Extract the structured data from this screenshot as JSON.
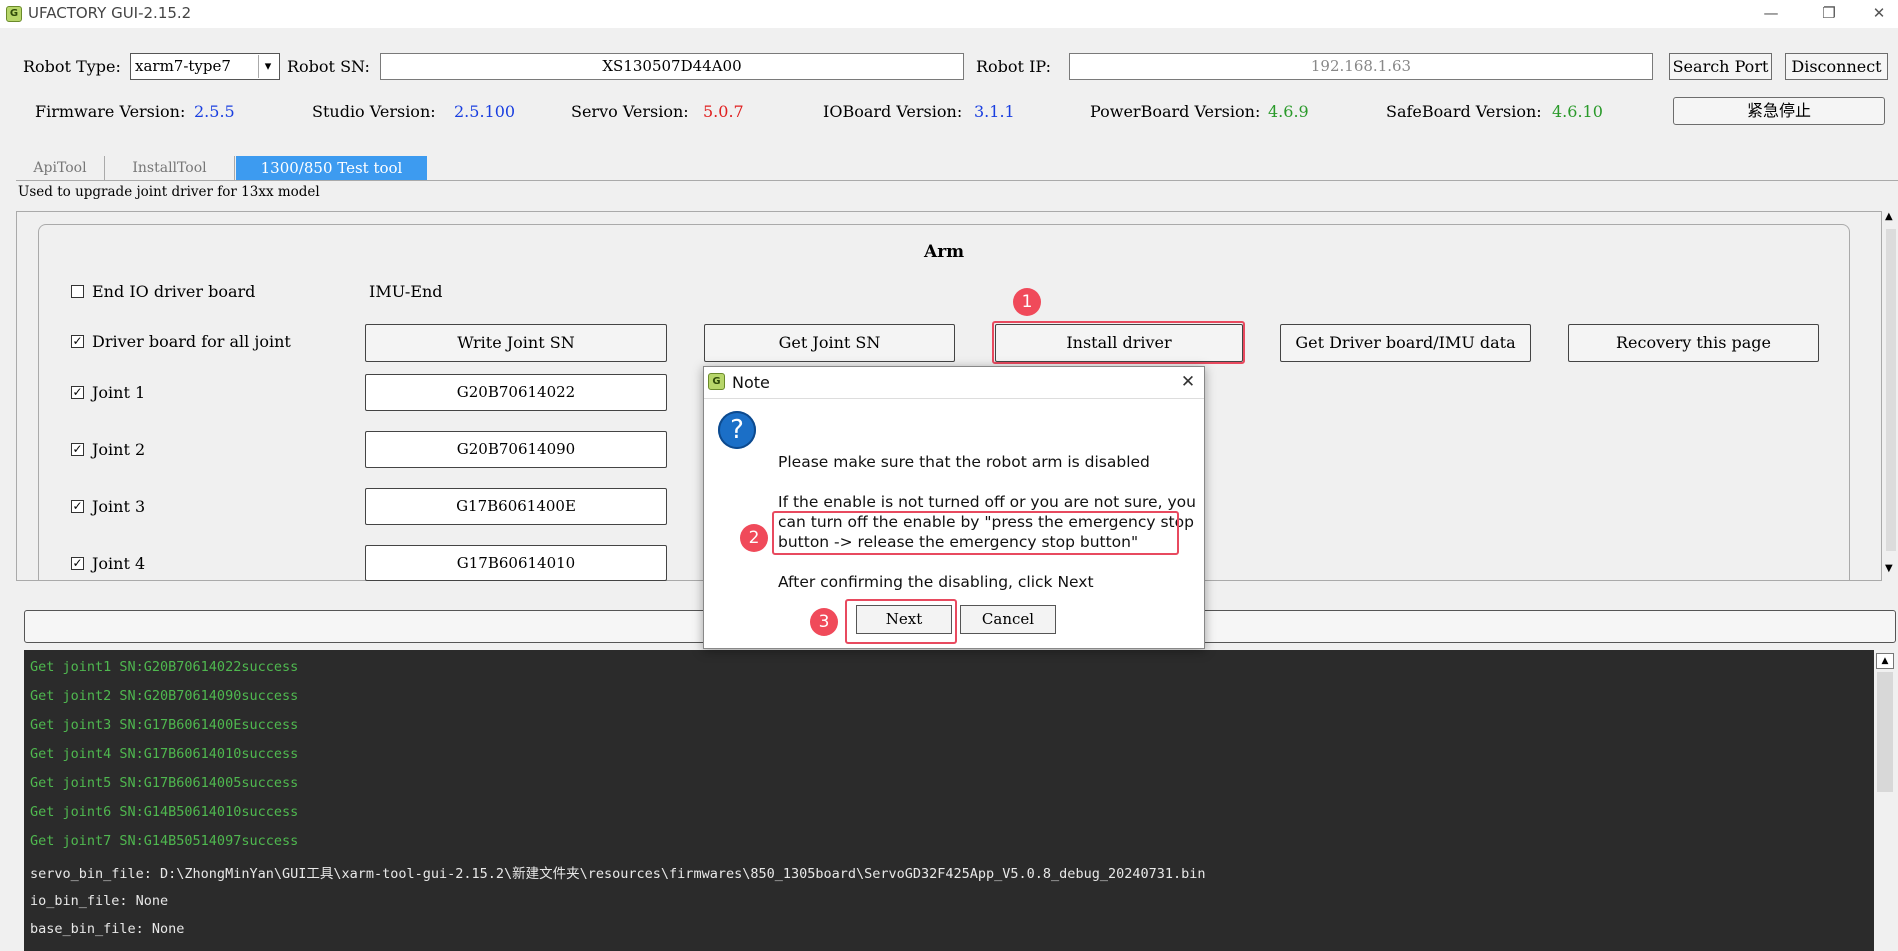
{
  "window": {
    "title": "UFACTORY GUI-2.15.2",
    "logo_icon": "ufactory-logo-icon",
    "minimize": "—",
    "restore": "❐",
    "close": "✕"
  },
  "robot": {
    "type_label": "Robot Type:",
    "type_value": "xarm7-type7",
    "sn_label": "Robot SN:",
    "sn_value": "XS130507D44A00",
    "ip_label": "Robot IP:",
    "ip_value": "192.168.1.63",
    "search_port": "Search Port",
    "disconnect": "Disconnect"
  },
  "versions": {
    "firmware_label": "Firmware Version:",
    "firmware": "2.5.5",
    "studio_label": "Studio Version:",
    "studio": "2.5.100",
    "servo_label": "Servo Version:",
    "servo": "5.0.7",
    "ioboard_label": "IOBoard Version:",
    "ioboard": "3.1.1",
    "powerboard_label": "PowerBoard Version:",
    "powerboard": "4.6.9",
    "safeboard_label": "SafeBoard Version:",
    "safeboard": "4.6.10",
    "estop": "紧急停止",
    "colors": {
      "blue": "#1a3fe0",
      "red": "#e02020",
      "green": "#2a9a2a"
    }
  },
  "tabs": [
    "ApiTool",
    "InstallTool",
    "1300/850 Test tool"
  ],
  "active_tab": 2,
  "tab_description": "Used to upgrade joint driver for 13xx model",
  "arm": {
    "title": "Arm",
    "end_io_label": "End IO driver board",
    "imu_end": "IMU-End",
    "driver_all_label": "Driver board for all joint",
    "buttons": {
      "write_sn": "Write Joint SN",
      "get_sn": "Get Joint SN",
      "install": "Install driver",
      "get_data": "Get Driver board/IMU data",
      "recovery": "Recovery this page"
    },
    "joints": [
      {
        "label": "Joint 1",
        "sn": "G20B70614022"
      },
      {
        "label": "Joint 2",
        "sn": "G20B70614090"
      },
      {
        "label": "Joint 3",
        "sn": "G17B6061400E"
      },
      {
        "label": "Joint 4",
        "sn": "G17B60614010"
      }
    ]
  },
  "log": [
    "Get joint1 SN:G20B70614022success",
    "Get joint2 SN:G20B70614090success",
    "Get joint3 SN:G17B6061400Esuccess",
    "Get joint4 SN:G17B60614010success",
    "Get joint5 SN:G17B60614005success",
    "Get joint6 SN:G14B50614010success",
    "Get joint7 SN:G14B50514097success",
    "servo_bin_file: D:\\ZhongMinYan\\GUI工具\\xarm-tool-gui-2.15.2\\新建文件夹\\resources\\firmwares\\850_1305board\\ServoGD32F425App_V5.0.8_debug_20240731.bin",
    "io_bin_file: None",
    "base_bin_file: None"
  ],
  "dialog": {
    "title": "Note",
    "question_icon": "?",
    "line1": "Please make sure that the robot arm is disabled",
    "line2": "If the enable is not turned off or you are not sure, you",
    "line3": "can turn off the enable by \"press the emergency stop",
    "line4": "button -> release the emergency stop button\"",
    "line5": "After confirming the disabling, click Next",
    "next": "Next",
    "cancel": "Cancel",
    "close": "✕"
  },
  "markers": [
    "1",
    "2",
    "3"
  ]
}
